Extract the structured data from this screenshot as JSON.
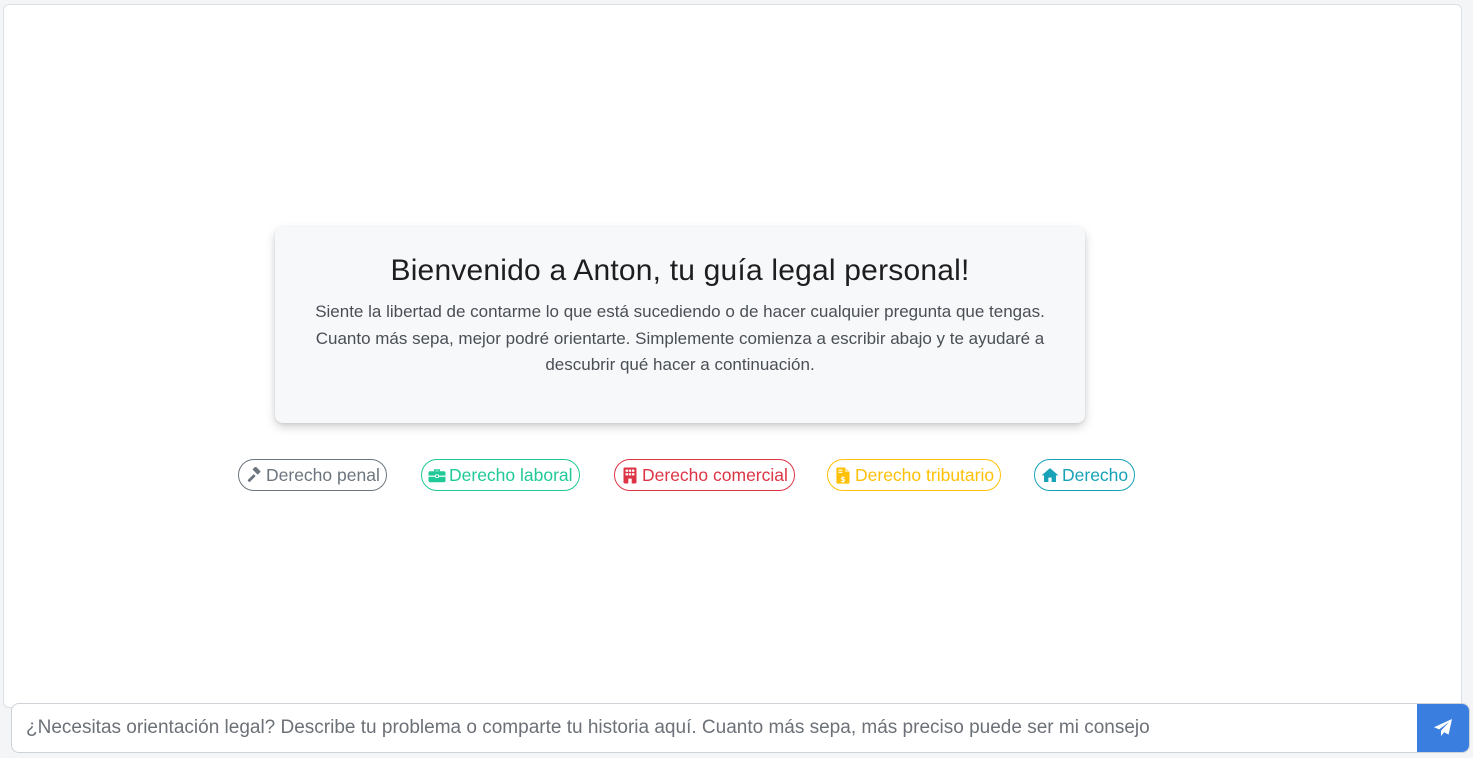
{
  "welcome": {
    "title": "Bienvenido a Anton, tu guía legal personal!",
    "message": "Siente la libertad de contarme lo que está sucediendo o de hacer cualquier pregunta que tengas. Cuanto más sepa, mejor podré orientarte. Simplemente comienza a escribir abajo y te ayudaré a descubrir qué hacer a continuación."
  },
  "topics": [
    {
      "label": "Derecho penal",
      "icon": "gavel-icon",
      "color": "#6c757d"
    },
    {
      "label": "Derecho laboral",
      "icon": "briefcase-icon",
      "color": "#20c997"
    },
    {
      "label": "Derecho comercial",
      "icon": "building-icon",
      "color": "#dc3545"
    },
    {
      "label": "Derecho tributario",
      "icon": "invoice-dollar-icon",
      "color": "#ffc107"
    },
    {
      "label": "Derecho",
      "icon": "home-icon",
      "color": "#17a2b8"
    }
  ],
  "composer": {
    "placeholder": "¿Necesitas orientación legal? Describe tu problema o comparte tu historia aquí. Cuanto más sepa, más preciso puede ser mi consejo",
    "value": "",
    "send_icon": "paper-plane-icon",
    "send_color": "#3a7fe0"
  }
}
